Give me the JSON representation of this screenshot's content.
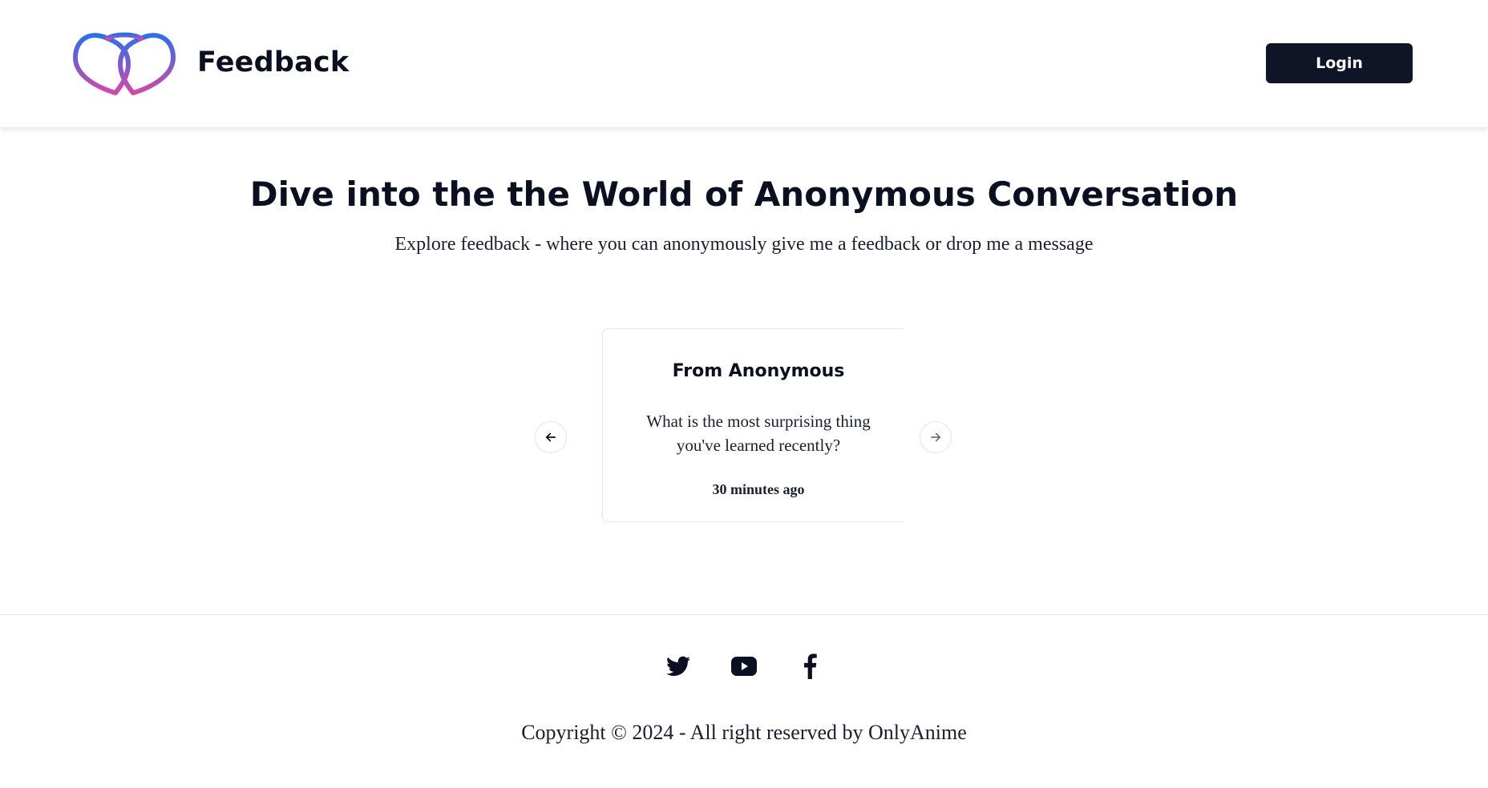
{
  "header": {
    "brand_name": "Feedback",
    "logo_icon": "intertwined-hearts-logo",
    "login_label": "Login"
  },
  "hero": {
    "title": "Dive into the the World of Anonymous Conversation",
    "subtitle": "Explore feedback - where you can anonymously give me a feedback or drop me a message"
  },
  "carousel": {
    "prev_icon": "arrow-left-icon",
    "next_icon": "arrow-right-icon",
    "card": {
      "title": "From Anonymous",
      "message": "What is the most surprising thing you've learned recently?",
      "time": "30 minutes ago"
    }
  },
  "footer": {
    "social": [
      {
        "name": "twitter-icon"
      },
      {
        "name": "youtube-icon"
      },
      {
        "name": "facebook-icon"
      }
    ],
    "copyright": "Copyright © 2024 - All right reserved by OnlyAnime"
  },
  "colors": {
    "primary_dark": "#0f1526",
    "logo_gradient_start": "#2f6fe6",
    "logo_gradient_end": "#d04aa8",
    "border": "#e3e5ea"
  }
}
